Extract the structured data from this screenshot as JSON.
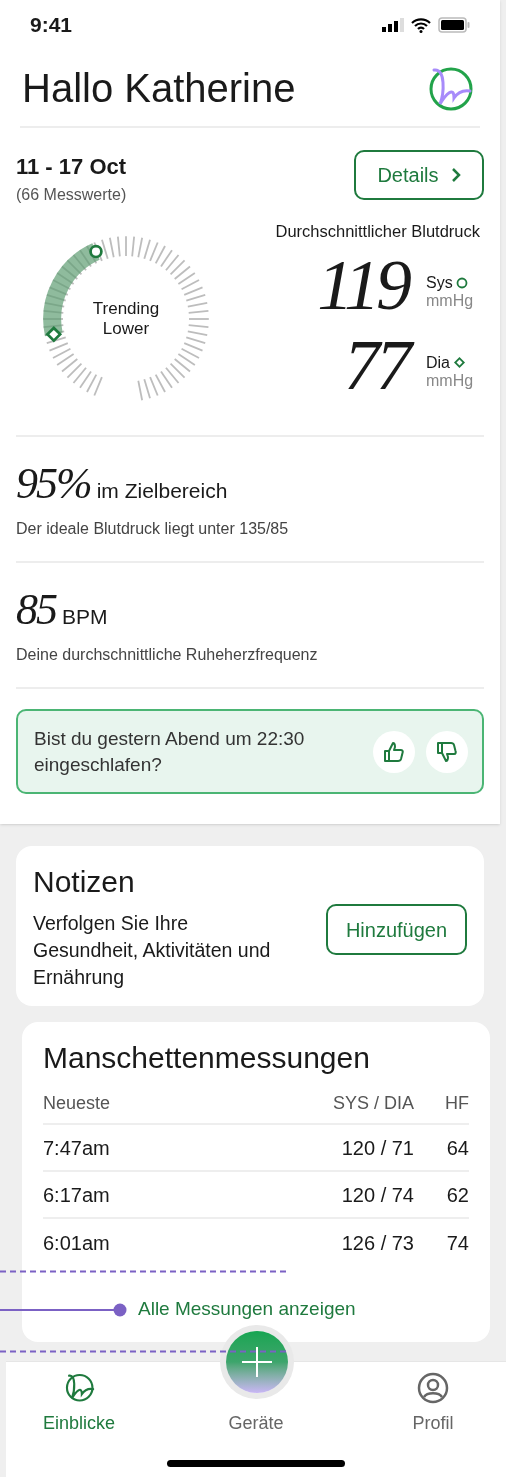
{
  "status_bar": {
    "time": "9:41"
  },
  "header": {
    "greeting": "Hallo Katherine"
  },
  "summary": {
    "date_range": "11 - 17 Oct",
    "count": "(66 Messwerte)",
    "details_button": "Details",
    "trend_label": "Trending Lower",
    "avg_title": "Durchschnittlicher Blutdruck",
    "readings": [
      {
        "value": "119",
        "label": "Sys",
        "unit": "mmHg"
      },
      {
        "value": "77",
        "label": "Dia",
        "unit": "mmHg"
      }
    ]
  },
  "stats": [
    {
      "value": "95%",
      "unit": "im Zielbereich",
      "description": "Der ideale Blutdruck liegt unter 135/85"
    },
    {
      "value": "85",
      "unit": "BPM",
      "description": "Deine durchschnittliche Ruheherzfrequenz"
    }
  ],
  "prompt": {
    "question": "Bist du gestern Abend um 22:30 eingeschlafen?"
  },
  "notes": {
    "title": "Notizen",
    "text": "Verfolgen Sie Ihre Gesundheit, Aktivitäten und Ernährung",
    "button": "Hinzufügen"
  },
  "measurements": {
    "title": "Manschettenmessungen",
    "columns": [
      "Neueste",
      "SYS / DIA",
      "HF"
    ],
    "rows": [
      [
        "7:47am",
        "120 / 71",
        "64"
      ],
      [
        "6:17am",
        "120 / 74",
        "62"
      ],
      [
        "6:01am",
        "126 / 73",
        "74"
      ]
    ],
    "link": "Alle Messungen anzeigen"
  },
  "tab_bar": {
    "tabs": [
      {
        "label": "Einblicke",
        "selected": true
      },
      {
        "label": "Geräte",
        "selected": false
      },
      {
        "label": "Profil",
        "selected": false
      }
    ]
  }
}
